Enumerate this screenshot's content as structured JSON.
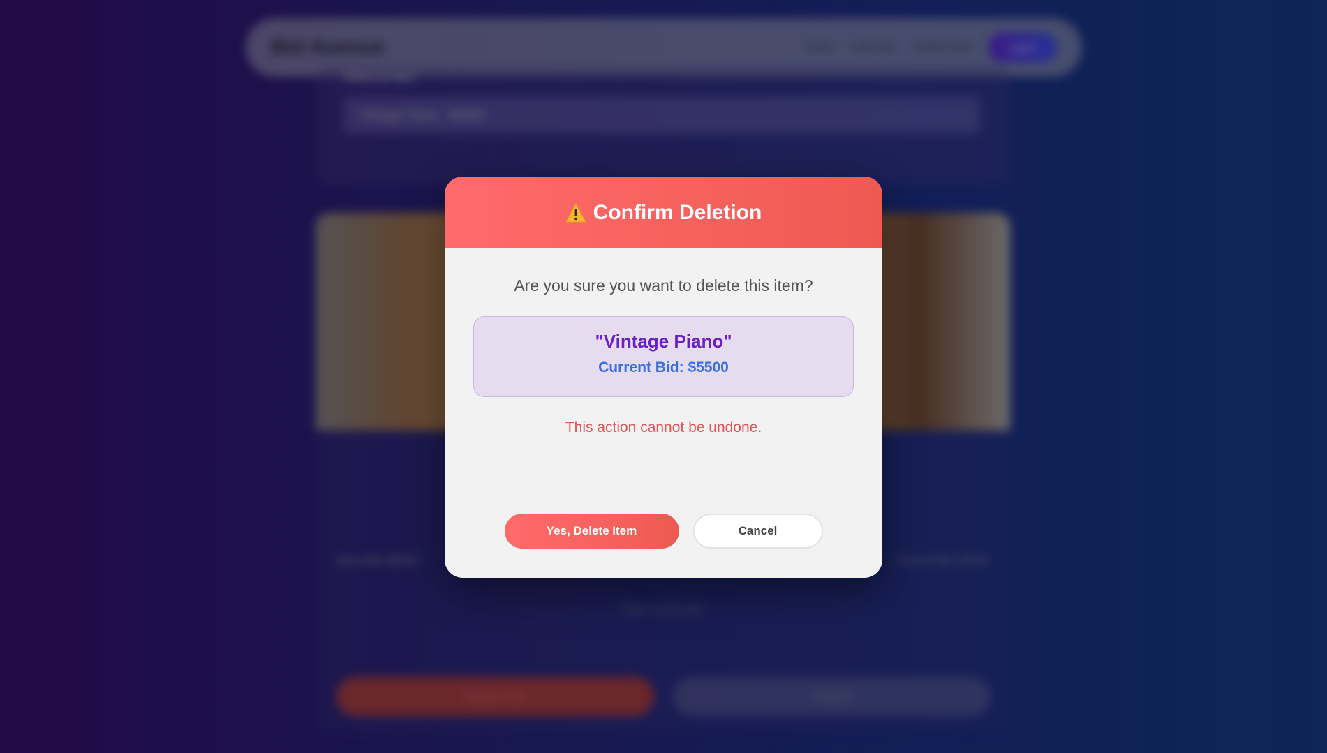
{
  "background": {
    "brand": "Bid Avenue",
    "nav_links": [
      "Items",
      "Add Item",
      "Delete Item"
    ],
    "nav_button": "Log In",
    "select_label": "Select an Item",
    "select_value": "Vintage Piano - $5500",
    "stat_left": "Base Bid: $5000",
    "stat_right": "Current Bid: $5500",
    "ends_text": "Ends in 3d 2h 45m",
    "delete_button": "Delete Item",
    "cancel_button": "Cancel"
  },
  "modal": {
    "icon": "warning-icon",
    "title": "Confirm Deletion",
    "question": "Are you sure you want to delete this item?",
    "item_name": "\"Vintage Piano\"",
    "item_bid": "Current Bid: $5500",
    "warning": "This action cannot be undone.",
    "confirm_label": "Yes, Delete Item",
    "cancel_label": "Cancel"
  },
  "colors": {
    "header_red": "#ff6b6b",
    "item_purple": "#6a1fc7",
    "bid_blue": "#3a6fe0",
    "warning_red": "#e05454"
  }
}
